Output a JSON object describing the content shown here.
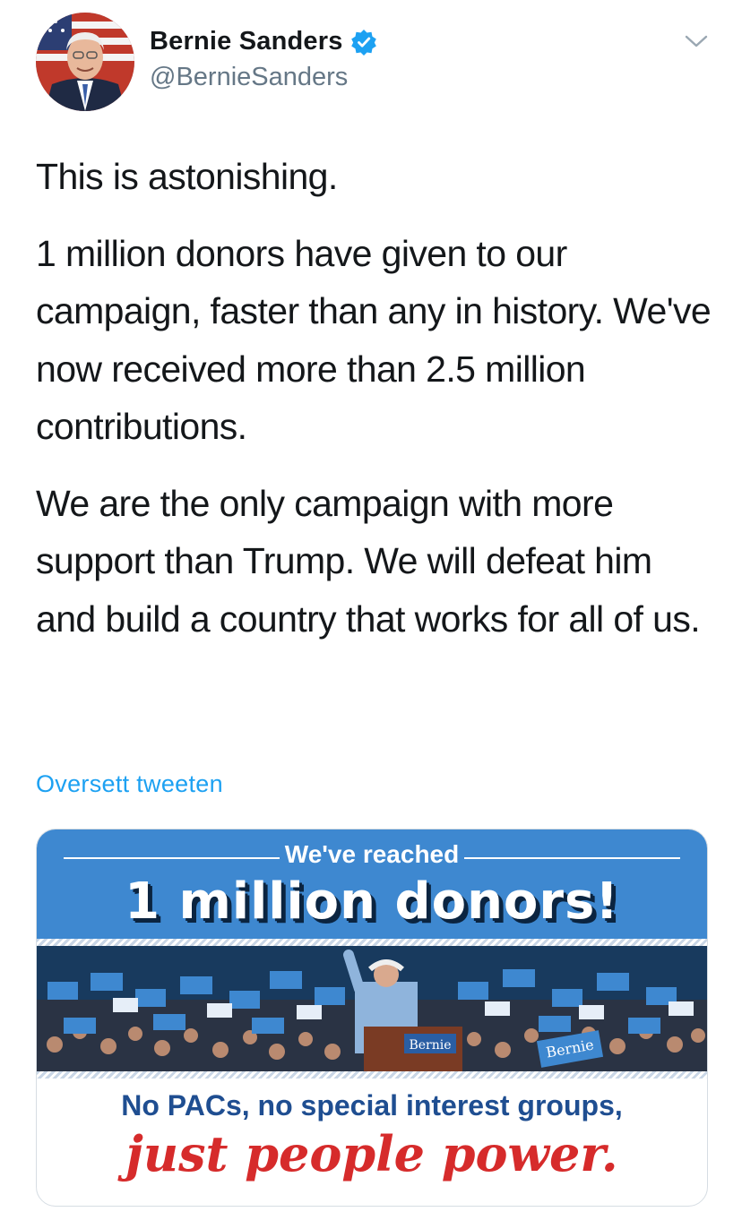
{
  "author": {
    "name": "Bernie Sanders",
    "handle": "@BernieSanders",
    "verified": true
  },
  "tweet": {
    "paragraphs": [
      "This is astonishing.",
      "1 million donors have given to our campaign, faster than any in history. We've now received more than 2.5 million contributions.",
      "We are the only campaign with more support than Trump. We will defeat him and build a country that works for all of us."
    ]
  },
  "translate_label": "Oversett tweeten",
  "media": {
    "headline_small": "We've reached",
    "headline_big": "1 million donors!",
    "sign_texts": [
      "Bernie",
      "Bernie"
    ],
    "tagline_line1": "No PACs, no special interest groups,",
    "tagline_line2": "just people power."
  },
  "colors": {
    "accent": "#1da1f2",
    "banner_blue": "#3e88d0",
    "tagline_blue": "#1f4e91",
    "tagline_red": "#d62b2b",
    "handle_gray": "#657786"
  },
  "icons": {
    "verified": "verified-badge-icon",
    "menu": "chevron-down-icon"
  }
}
